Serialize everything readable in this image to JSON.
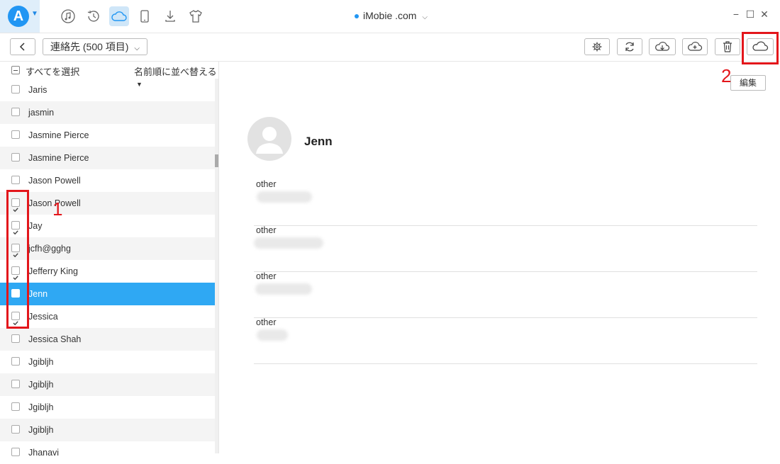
{
  "title_bar": {
    "device_name": "iMobie .com",
    "nav_icons": [
      "music-icon",
      "history-icon",
      "cloud-icon",
      "phone-icon",
      "download-icon",
      "tshirt-icon"
    ],
    "window_controls": [
      "−",
      "☐",
      "✕"
    ]
  },
  "toolbar": {
    "category_label": "連絡先 (500 項目)",
    "buttons": [
      "settings-icon",
      "refresh-icon",
      "cloud-download-icon",
      "cloud-upload-icon",
      "trash-icon",
      "cloud-icon"
    ]
  },
  "list": {
    "select_all_label": "すべてを選択",
    "sort_label": "名前順に並べ替える",
    "items": [
      {
        "name": "Jaris",
        "checked": false
      },
      {
        "name": "jasmin",
        "checked": false
      },
      {
        "name": "Jasmine Pierce",
        "checked": false
      },
      {
        "name": "Jasmine Pierce",
        "checked": false
      },
      {
        "name": "Jason Powell",
        "checked": false
      },
      {
        "name": "Jason Powell",
        "checked": true
      },
      {
        "name": "Jay",
        "checked": true
      },
      {
        "name": "jcfh@gghg",
        "checked": true
      },
      {
        "name": "Jefferry King",
        "checked": true
      },
      {
        "name": "Jenn",
        "checked": true,
        "selected": true
      },
      {
        "name": "Jessica",
        "checked": true
      },
      {
        "name": "Jessica Shah",
        "checked": false
      },
      {
        "name": "Jgibljh",
        "checked": false
      },
      {
        "name": "Jgibljh",
        "checked": false
      },
      {
        "name": "Jgibljh",
        "checked": false
      },
      {
        "name": "Jgibljh",
        "checked": false
      },
      {
        "name": "Jhanavi",
        "checked": false
      }
    ]
  },
  "detail": {
    "edit_label": "編集",
    "contact_name": "Jenn",
    "fields": [
      {
        "label": "other"
      },
      {
        "label": "other"
      },
      {
        "label": "other"
      },
      {
        "label": "other"
      }
    ]
  },
  "annotations": {
    "step1": "1",
    "step2": "2"
  },
  "colors": {
    "accent": "#2196f3",
    "selected_row": "#2fa8f3",
    "annotation_red": "#e3161b"
  }
}
